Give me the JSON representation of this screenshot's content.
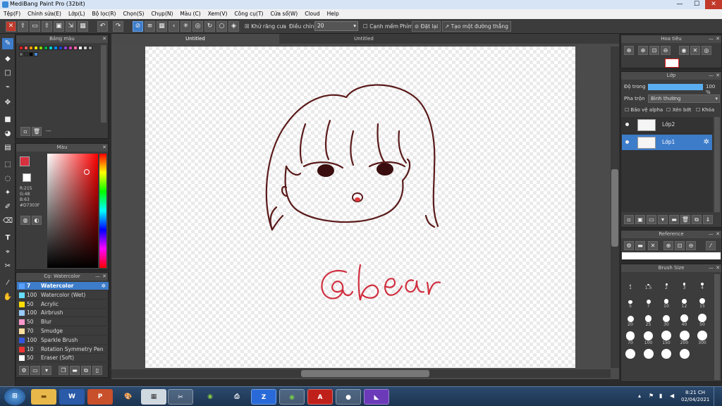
{
  "window": {
    "title": "MediBang Paint Pro (32bit)"
  },
  "menu": [
    "Tệp(F)",
    "Chỉnh sửa(E)",
    "Lớp(L)",
    "Bộ lọc(R)",
    "Chọn(S)",
    "Chụp(N)",
    "Màu (C)",
    "Xem(V)",
    "Công cụ(T)",
    "Cửa sổ(W)",
    "Cloud",
    "Help"
  ],
  "toolbar": {
    "antialias_label": "Khử răng cưa",
    "correction_label": "Điều chỉnh",
    "correction_value": "20",
    "soften_label": "Cạnh mềm",
    "key_label": "Phím",
    "reset_label": "Đặt lại",
    "new_brush_label": "Tạo một đường thẳng"
  },
  "palette_panel": {
    "title": "Bảng màu",
    "footer_text": "---",
    "swatches": [
      "#e02020",
      "#ff6060",
      "#ff9900",
      "#ffee00",
      "#88cc00",
      "#00aa44",
      "#00cccc",
      "#0088ff",
      "#2244cc",
      "#8844cc",
      "#cc44aa",
      "#ff66aa",
      "#ffffff",
      "#cccccc",
      "#999999",
      "#666666",
      "#333333",
      "#000000",
      "#4a8ad6"
    ]
  },
  "color_panel": {
    "title": "Màu",
    "r": "R:215",
    "g": "G:48",
    "b": "B:63",
    "hex": "#D7303F",
    "primary": "#d7303f",
    "secondary": "#ffffff"
  },
  "brush_panel": {
    "title": "Cọ: Watercolor",
    "brushes": [
      {
        "size": "7",
        "name": "Watercolor",
        "color": "#5aa0ff",
        "selected": true
      },
      {
        "size": "100",
        "name": "Watercolor (Wet)",
        "color": "#66ddff"
      },
      {
        "size": "50",
        "name": "Acrylic",
        "color": "#ffdd00"
      },
      {
        "size": "100",
        "name": "Airbrush",
        "color": "#99ccff"
      },
      {
        "size": "50",
        "name": "Blur",
        "color": "#ff99cc"
      },
      {
        "size": "70",
        "name": "Smudge",
        "color": "#ffe0a0"
      },
      {
        "size": "100",
        "name": "Sparkle Brush",
        "color": "#3355dd"
      },
      {
        "size": "10",
        "name": "Rotation Symmetry Pen",
        "color": "#ee3333"
      },
      {
        "size": "50",
        "name": "Eraser (Soft)",
        "color": "#ffffff"
      }
    ]
  },
  "doc_tabs": [
    "Untitled",
    "Untitled"
  ],
  "canvas": {
    "signature": "@ bear"
  },
  "navigator_panel": {
    "title": "Hoa tiêu"
  },
  "layer_panel": {
    "title": "Lớp",
    "opacity_label": "Độ trong",
    "opacity_value": "100 %",
    "opacity": 1.0,
    "blend_label": "Pha trộn",
    "blend_value": "Bình thường",
    "protect_alpha": "Bảo vệ alpha",
    "clipping": "Xén bớt",
    "lock": "Khóa",
    "layers": [
      {
        "name": "Lớp2",
        "selected": false
      },
      {
        "name": "Lớp1",
        "selected": true
      }
    ]
  },
  "reference_panel": {
    "title": "Reference"
  },
  "brush_size_panel": {
    "title": "Brush Size",
    "sizes": [
      "1",
      "1.5",
      "2",
      "3",
      "4",
      "5",
      "7",
      "10",
      "12",
      "15",
      "20",
      "25",
      "30",
      "40",
      "50",
      "70",
      "100",
      "150",
      "200",
      "300",
      "",
      "",
      "",
      ""
    ]
  },
  "taskbar": {
    "time": "8:21 CH",
    "date": "02/04/2021",
    "apps": [
      "win-logo",
      "folder",
      "word",
      "powerpoint",
      "paint-brush",
      "calculator",
      "snip",
      "chrome-alt",
      "printer",
      "zalo",
      "chrome",
      "pdf",
      "medibang",
      "visual-studio"
    ]
  }
}
